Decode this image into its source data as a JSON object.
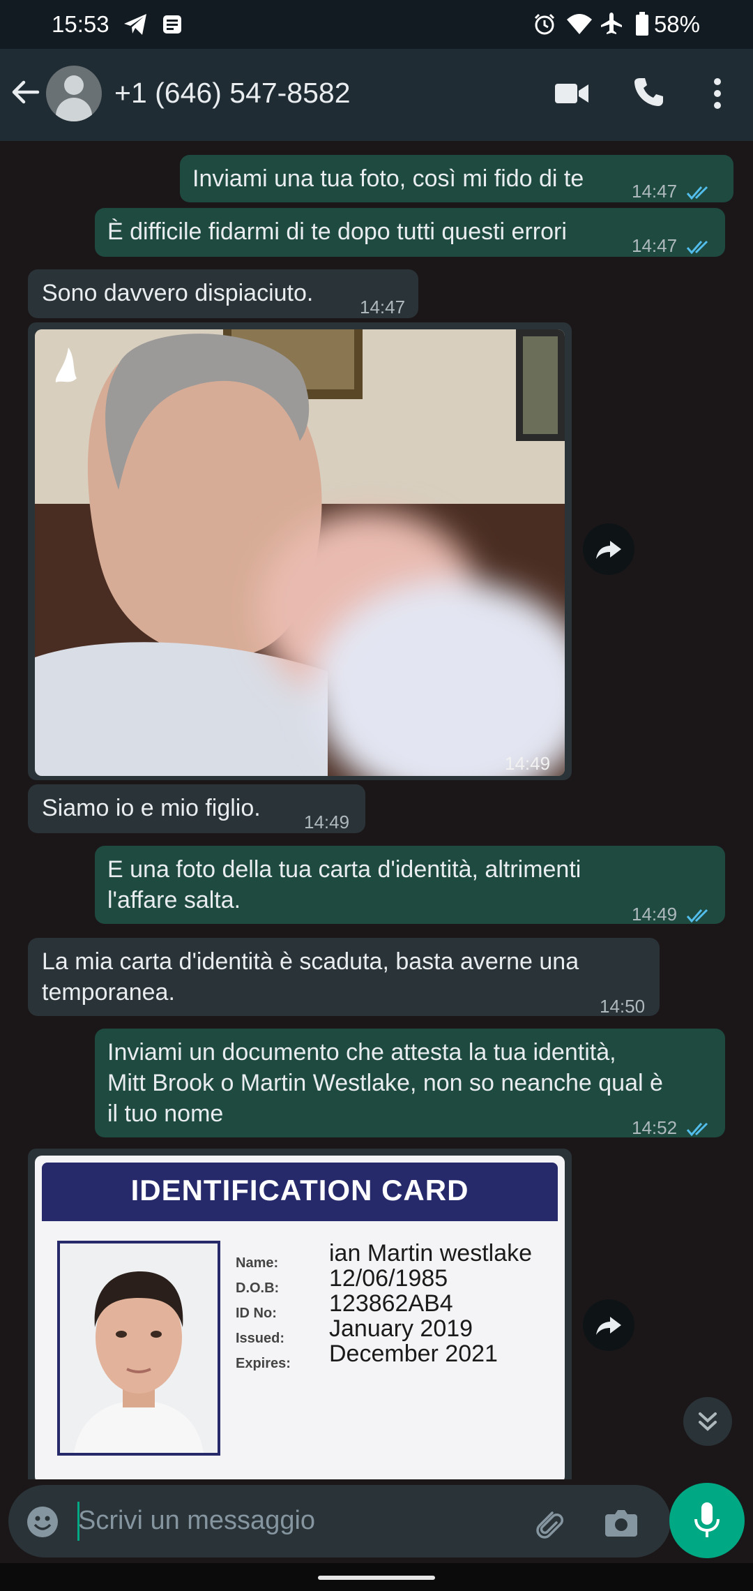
{
  "status_bar": {
    "time": "15:53",
    "battery": "58%",
    "icons": [
      "telegram-icon",
      "news-icon",
      "alarm-icon",
      "wifi-icon",
      "airplane-icon",
      "battery-icon"
    ]
  },
  "header": {
    "contact_name": "+1 (646) 547-8582",
    "icons": [
      "back-arrow-icon",
      "avatar",
      "video-call-icon",
      "phone-call-icon",
      "more-icon"
    ]
  },
  "messages": [
    {
      "dir": "out",
      "text": "Inviami una tua foto, così mi fido di te",
      "time": "14:47",
      "read": true
    },
    {
      "dir": "out",
      "text": "È difficile fidarmi di te dopo tutti questi errori",
      "time": "14:47",
      "read": true
    },
    {
      "dir": "in",
      "text": "Sono davvero dispiaciuto.",
      "time": "14:47"
    },
    {
      "dir": "in",
      "type": "image",
      "description_icon": "photo-image",
      "time": "14:49"
    },
    {
      "dir": "in",
      "text": "Siamo io e mio figlio.",
      "time": "14:49"
    },
    {
      "dir": "out",
      "text_lines": [
        "E una foto della tua carta d'identità, altrimenti",
        "l'affare salta."
      ],
      "time": "14:49",
      "read": true
    },
    {
      "dir": "in",
      "text_lines": [
        "La mia carta d'identità è scaduta, basta averne una",
        "temporanea."
      ],
      "time": "14:50"
    },
    {
      "dir": "out",
      "text_lines": [
        "Inviami un documento che attesta la tua identità,",
        "Mitt Brook o Martin Westlake, non so neanche qual è",
        "il tuo nome"
      ],
      "time": "14:52",
      "read": true
    },
    {
      "dir": "in",
      "type": "image",
      "id_card": {
        "title": "IDENTIFICATION CARD",
        "fields": [
          {
            "label": "Name:",
            "value": "ian Martin westlake"
          },
          {
            "label": "D.O.B:",
            "value": "12/06/1985"
          },
          {
            "label": "ID No:",
            "value": "123862AB4"
          },
          {
            "label": "Issued:",
            "value": "January  2019"
          },
          {
            "label": "Expires:",
            "value": "December  2021"
          }
        ]
      }
    }
  ],
  "composer": {
    "placeholder": "Scrivi un messaggio",
    "icons": [
      "emoji-icon",
      "attach-icon",
      "camera-icon",
      "mic-icon"
    ]
  },
  "colors": {
    "accent": "#00a884",
    "outgoing_bubble": "#1e4a40",
    "incoming_bubble": "#2a3338",
    "read_ticks": "#53bdeb"
  }
}
